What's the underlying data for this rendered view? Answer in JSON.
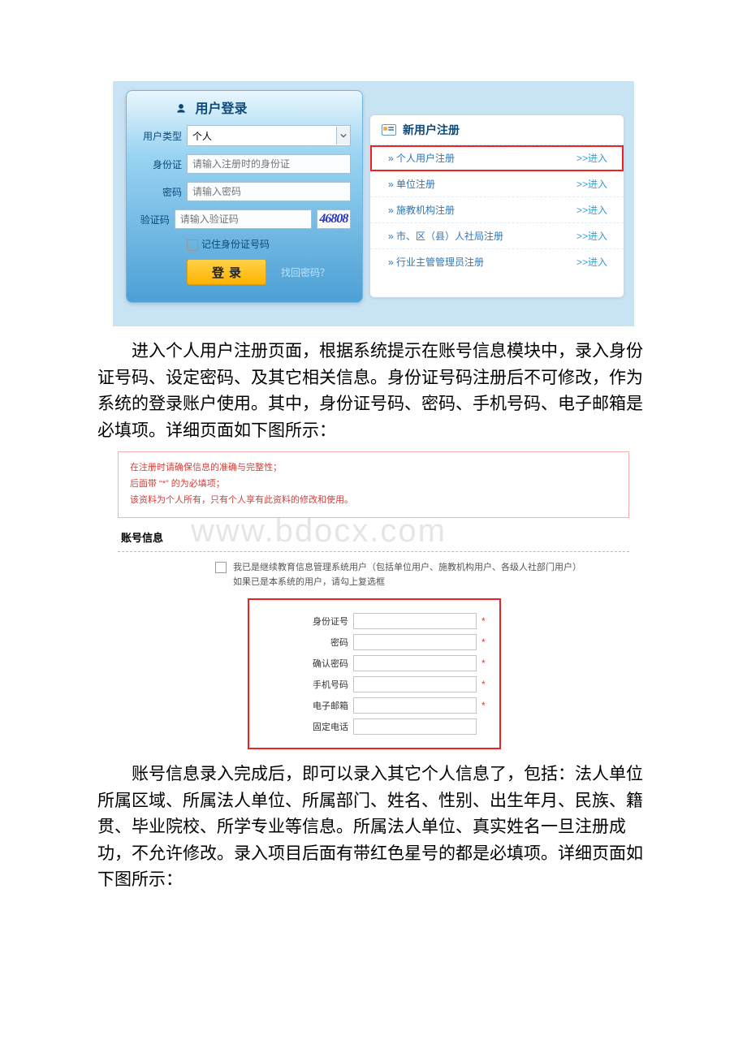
{
  "login": {
    "header": "用户登录",
    "rows": {
      "userType": {
        "label": "用户类型",
        "value": "个人"
      },
      "idcard": {
        "label": "身份证",
        "placeholder": "请输入注册时的身份证"
      },
      "password": {
        "label": "密码",
        "placeholder": "请输入密码"
      },
      "captcha": {
        "label": "验证码",
        "placeholder": "请输入验证码",
        "image_text": "46808"
      }
    },
    "remember": "记住身份证号码",
    "submit": "登录",
    "forgot": "找回密码？"
  },
  "register": {
    "header": "新用户注册",
    "items": [
      {
        "label": "» 个人用户注册",
        "enter": ">>进入",
        "highlight": true
      },
      {
        "label": "» 单位注册",
        "enter": ">>进入",
        "highlight": false
      },
      {
        "label": "» 施教机构注册",
        "enter": ">>进入",
        "highlight": false
      },
      {
        "label": "» 市、区（县）人社局注册",
        "enter": ">>进入",
        "highlight": false
      },
      {
        "label": "» 行业主管管理员注册",
        "enter": ">>进入",
        "highlight": false
      }
    ]
  },
  "paragraphs": {
    "p1": "进入个人用户注册页面，根据系统提示在账号信息模块中，录入身份证号码、设定密码、及其它相关信息。身份证号码注册后不可修改，作为系统的登录账户使用。其中，身份证号码、密码、手机号码、电子邮箱是必填项。详细页面如下图所示：",
    "p2": "账号信息录入完成后，即可以录入其它个人信息了，包括：法人单位所属区域、所属法人单位、所属部门、姓名、性别、出生年月、民族、籍贯、毕业院校、所学专业等信息。所属法人单位、真实姓名一旦注册成功，不允许修改。录入项目后面有带红色星号的都是必填项。详细页面如下图所示："
  },
  "form": {
    "warn": {
      "l1": "在注册时请确保信息的准确与完整性；",
      "l2": "后面带 “*” 的为必填项；",
      "l3": "该资料为个人所有，只有个人享有此资料的修改和使用。"
    },
    "watermark": "www.bdocx.com",
    "section": "账号信息",
    "existing": {
      "l1": "我已是继续教育信息管理系统用户（包括单位用户、施教机构用户、各级人社部门用户）",
      "l2": "如果已是本系统的用户，请勾上复选框"
    },
    "fields": [
      {
        "label": "身份证号",
        "required": true
      },
      {
        "label": "密码",
        "required": true
      },
      {
        "label": "确认密码",
        "required": true
      },
      {
        "label": "手机号码",
        "required": true
      },
      {
        "label": "电子邮箱",
        "required": true
      },
      {
        "label": "固定电话",
        "required": false
      }
    ]
  }
}
